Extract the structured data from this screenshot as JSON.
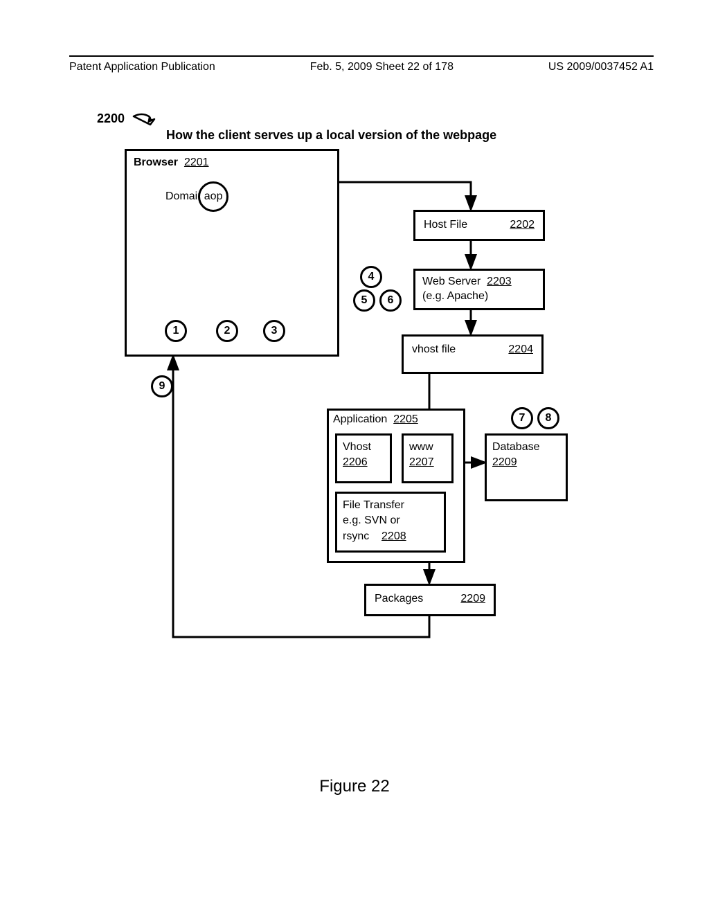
{
  "header": {
    "left": "Patent Application Publication",
    "mid": "Feb. 5, 2009  Sheet 22 of 178",
    "right": "US 2009/0037452 A1"
  },
  "figure_ref": "2200",
  "diagram_title": "How the client serves up a local version of the webpage",
  "browser": {
    "label": "Browser",
    "ref": "2201",
    "domain_label": "Domain",
    "domain_val": "aop"
  },
  "hostfile": {
    "label": "Host File",
    "ref": "2202"
  },
  "webserver": {
    "label": "Web Server",
    "ref": "2203",
    "sub": "(e.g. Apache)"
  },
  "vhostfile": {
    "label": "vhost file",
    "ref": "2204"
  },
  "application": {
    "label": "Application",
    "ref": "2205"
  },
  "vhost": {
    "label": "Vhost",
    "ref": "2206"
  },
  "www": {
    "label": "www",
    "ref": "2207"
  },
  "filetransfer": {
    "label1": "File Transfer",
    "label2": "e.g. SVN or",
    "label3": "rsync",
    "ref": "2208"
  },
  "database": {
    "label": "Database",
    "ref": "2209"
  },
  "packages": {
    "label": "Packages",
    "ref": "2209"
  },
  "circles": {
    "c1": "1",
    "c2": "2",
    "c3": "3",
    "c4": "4",
    "c5": "5",
    "c6": "6",
    "c7": "7",
    "c8": "8",
    "c9": "9"
  },
  "figure_label": "Figure 22"
}
